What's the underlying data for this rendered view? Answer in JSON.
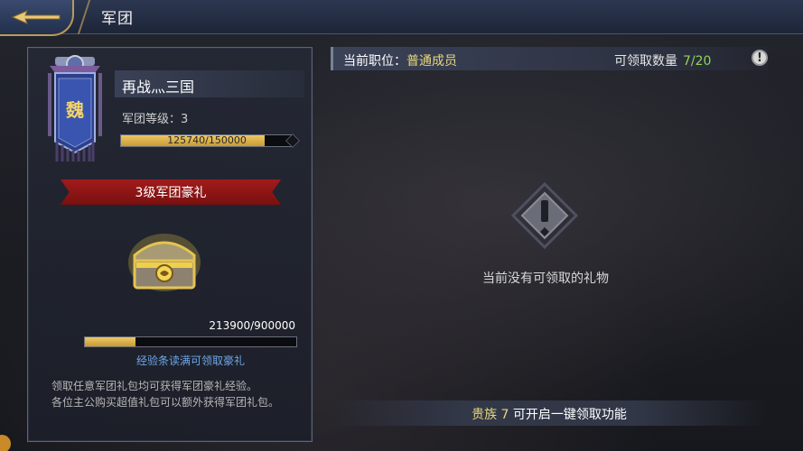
{
  "header": {
    "title": "军团",
    "back_icon": "back-arrow-icon"
  },
  "guild": {
    "emblem_char": "魏",
    "name": "再战灬三国",
    "level_text": "军团等级：3",
    "exp_text": "125740/150000",
    "exp_progress": 0.838
  },
  "gift": {
    "title": "3级军团豪礼",
    "exp_text": "213900/900000",
    "exp_progress": 0.2377,
    "hint": "经验条读满可领取豪礼",
    "description_line1": "领取任意军团礼包均可获得军团豪礼经验。",
    "description_line2": "各位主公购买超值礼包可以额外获得军团礼包。"
  },
  "info": {
    "role_label": "当前职位：",
    "role_value": "普通成员",
    "claim_label": "可领取数量",
    "claim_value": "7/20",
    "alert_symbol": "!"
  },
  "empty": {
    "message": "当前没有可领取的礼物"
  },
  "vip": {
    "level": "贵族 7",
    "text": "可开启一键领取功能"
  },
  "colors": {
    "gold": "#e8d77a",
    "green": "#8fd45a",
    "blue_hint": "#6fa6e8",
    "ribbon_red": "#a11b1b"
  }
}
